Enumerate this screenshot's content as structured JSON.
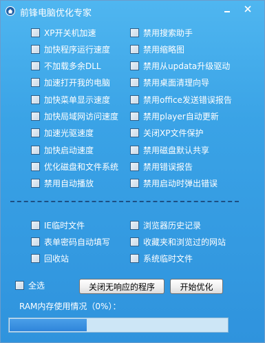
{
  "window": {
    "title": "前锋电脑优化专家"
  },
  "options_left": [
    "XP开关机加速",
    "加快程序运行速度",
    "不加载多余DLL",
    "加速打开我的电脑",
    "加快菜单显示速度",
    "加快局域网访问速度",
    "加速光驱速度",
    "加快启动速度",
    "优化磁盘和文件系统",
    "禁用自动播放"
  ],
  "options_right": [
    "禁用搜索助手",
    "禁用缩略图",
    "禁用从updata升级驱动",
    "禁用桌面清理向导",
    "禁用office发送错误报告",
    "禁用player自动更新",
    "关闭XP文件保护",
    "禁用磁盘默认共享",
    "禁用错误报告",
    "禁用启动时弹出错误"
  ],
  "clean_left": [
    "IE临时文件",
    "表单密码自动填写",
    "回收站"
  ],
  "clean_right": [
    "浏览器历史记录",
    "收藏夹和浏览过的网站",
    "系统临时文件"
  ],
  "footer": {
    "select_all": "全选",
    "close_unresponsive_button": "关闭无响应的程序",
    "start_button": "开始优化",
    "ram_status": "RAM内存使用情况（0%）：",
    "ram_usage_fraction": 0.355
  },
  "colors": {
    "window_bg": "#3aa3e6",
    "progress_fill": "#2f85da",
    "progress_track": "#cde6f6"
  }
}
